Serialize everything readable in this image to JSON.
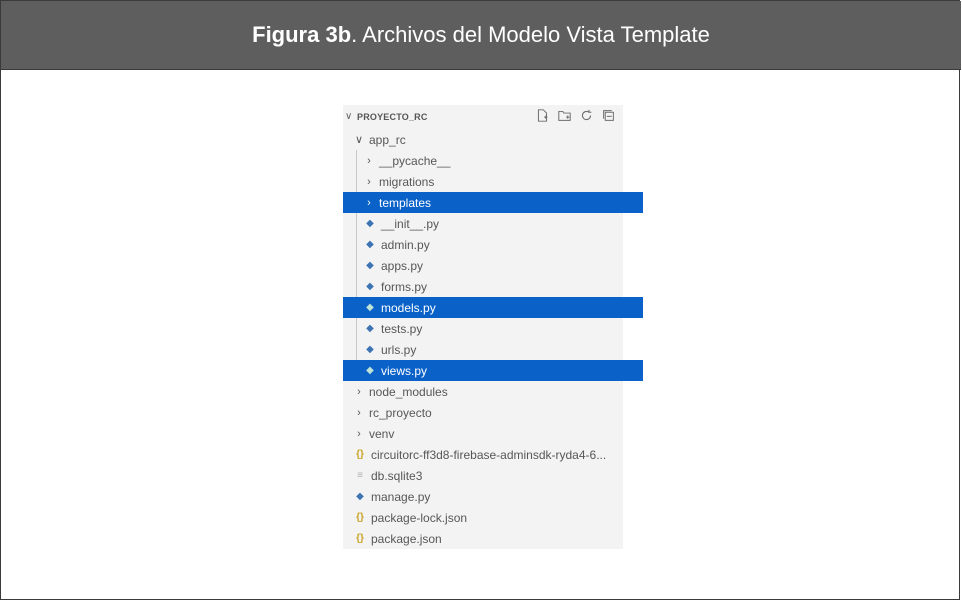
{
  "caption": {
    "prefix": "Figura 3b",
    "text": ". Archivos del Modelo Vista Template"
  },
  "explorer": {
    "title": "PROYECTO_RC",
    "actions": [
      "new-file-icon",
      "new-folder-icon",
      "refresh-icon",
      "collapse-all-icon"
    ],
    "items": [
      {
        "label": "app_rc",
        "kind": "folder",
        "expanded": true,
        "selected": false,
        "depth": 1
      },
      {
        "label": "__pycache__",
        "kind": "folder",
        "expanded": false,
        "selected": false,
        "depth": 2
      },
      {
        "label": "migrations",
        "kind": "folder",
        "expanded": false,
        "selected": false,
        "depth": 2
      },
      {
        "label": "templates",
        "kind": "folder",
        "expanded": false,
        "selected": true,
        "depth": 2
      },
      {
        "label": "__init__.py",
        "kind": "python",
        "selected": false,
        "depth": 2
      },
      {
        "label": "admin.py",
        "kind": "python",
        "selected": false,
        "depth": 2
      },
      {
        "label": "apps.py",
        "kind": "python",
        "selected": false,
        "depth": 2
      },
      {
        "label": "forms.py",
        "kind": "python",
        "selected": false,
        "depth": 2
      },
      {
        "label": "models.py",
        "kind": "python",
        "selected": true,
        "depth": 2
      },
      {
        "label": "tests.py",
        "kind": "python",
        "selected": false,
        "depth": 2
      },
      {
        "label": "urls.py",
        "kind": "python",
        "selected": false,
        "depth": 2
      },
      {
        "label": "views.py",
        "kind": "python",
        "selected": true,
        "depth": 2
      },
      {
        "label": "node_modules",
        "kind": "folder",
        "expanded": false,
        "selected": false,
        "depth": 1
      },
      {
        "label": "rc_proyecto",
        "kind": "folder",
        "expanded": false,
        "selected": false,
        "depth": 1
      },
      {
        "label": "venv",
        "kind": "folder",
        "expanded": false,
        "selected": false,
        "depth": 1
      },
      {
        "label": "circuitorc-ff3d8-firebase-adminsdk-ryda4-6...",
        "kind": "json",
        "selected": false,
        "depth": 1
      },
      {
        "label": "db.sqlite3",
        "kind": "db",
        "selected": false,
        "depth": 1
      },
      {
        "label": "manage.py",
        "kind": "python",
        "selected": false,
        "depth": 1
      },
      {
        "label": "package-lock.json",
        "kind": "json",
        "selected": false,
        "depth": 1
      },
      {
        "label": "package.json",
        "kind": "json",
        "selected": false,
        "depth": 1
      }
    ]
  },
  "colors": {
    "selection": "#0a62c9",
    "caption_bar": "#5e5e5e",
    "python_icon": "#3d73b2",
    "json_icon": "#c9a227"
  }
}
